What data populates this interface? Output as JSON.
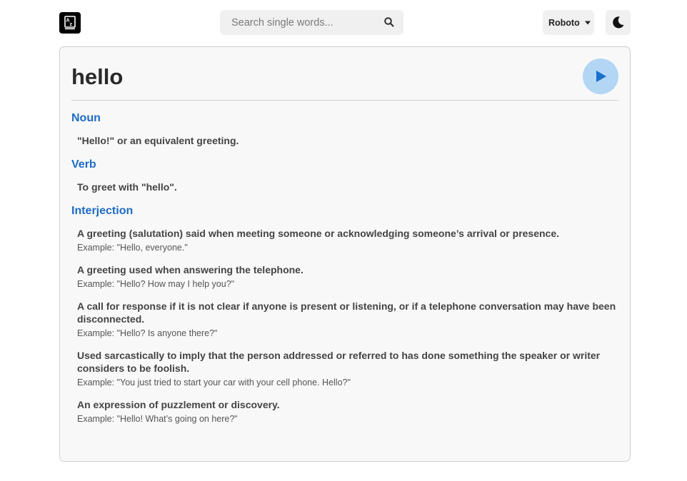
{
  "header": {
    "logo_icon": "az-dictionary-logo-icon",
    "search": {
      "placeholder": "Search single words...",
      "value": "",
      "icon": "search-icon"
    },
    "font_select": {
      "selected": "Roboto",
      "icon": "caret-down-icon"
    },
    "theme_toggle": {
      "icon": "moon-icon"
    }
  },
  "entry": {
    "word": "hello",
    "play_icon": "play-icon",
    "accent_color": "#1d6cc4",
    "play_button_color": "#b3d6f5",
    "meanings": [
      {
        "part_of_speech": "Noun",
        "definitions": [
          {
            "text": "\"Hello!\" or an equivalent greeting.",
            "example": ""
          }
        ]
      },
      {
        "part_of_speech": "Verb",
        "definitions": [
          {
            "text": "To greet with \"hello\".",
            "example": ""
          }
        ]
      },
      {
        "part_of_speech": "Interjection",
        "definitions": [
          {
            "text": "A greeting (salutation) said when meeting someone or acknowledging someone’s arrival or presence.",
            "example": "Example: \"Hello, everyone.\""
          },
          {
            "text": "A greeting used when answering the telephone.",
            "example": "Example: \"Hello? How may I help you?\""
          },
          {
            "text": "A call for response if it is not clear if anyone is present or listening, or if a telephone conversation may have been disconnected.",
            "example": "Example: \"Hello? Is anyone there?\""
          },
          {
            "text": "Used sarcastically to imply that the person addressed or referred to has done something the speaker or writer considers to be foolish.",
            "example": "Example: \"You just tried to start your car with your cell phone. Hello?\""
          },
          {
            "text": "An expression of puzzlement or discovery.",
            "example": "Example: \"Hello! What’s going on here?\""
          }
        ]
      }
    ]
  }
}
